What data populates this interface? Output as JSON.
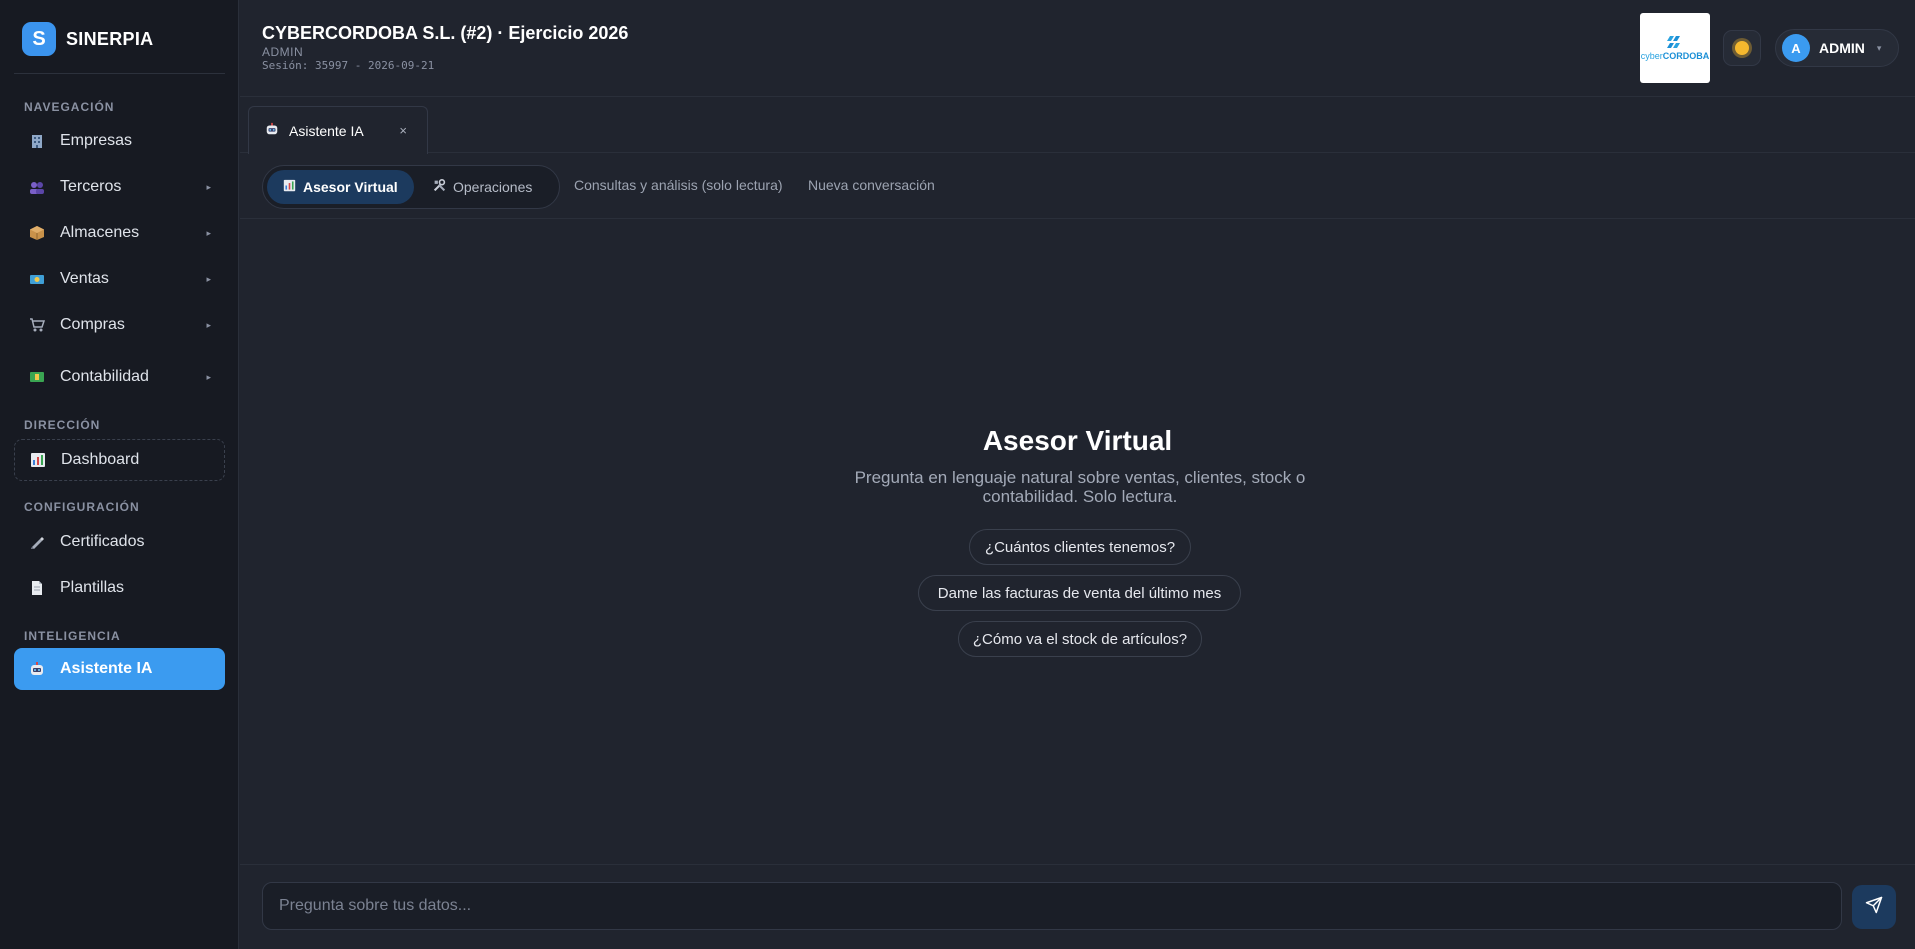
{
  "brand": {
    "logo_letter": "S",
    "name": "SINERPIA"
  },
  "sidebar": {
    "sections": {
      "navigation": "NAVEGACIÓN",
      "direction": "DIRECCIÓN",
      "configuration": "CONFIGURACIÓN",
      "intelligence": "INTELIGENCIA"
    },
    "items": [
      {
        "label": "Empresas",
        "icon": "building-icon"
      },
      {
        "label": "Terceros",
        "icon": "people-icon",
        "has_submenu": true
      },
      {
        "label": "Almacenes",
        "icon": "package-icon",
        "has_submenu": true
      },
      {
        "label": "Ventas",
        "icon": "money-icon",
        "has_submenu": true
      },
      {
        "label": "Compras",
        "icon": "cart-icon",
        "has_submenu": true
      },
      {
        "label": "Contabilidad",
        "icon": "ledger-icon",
        "has_submenu": true
      },
      {
        "label": "Dashboard",
        "icon": "bar-chart-icon"
      },
      {
        "label": "Certificados",
        "icon": "pen-icon"
      },
      {
        "label": "Plantillas",
        "icon": "document-icon"
      },
      {
        "label": "Asistente IA",
        "icon": "robot-icon",
        "active": true
      }
    ]
  },
  "header": {
    "company": "CYBERCORDOBA S.L. (#2) · Ejercicio 2026",
    "role": "ADMIN",
    "session": "Sesión: 35997 - 2026-09-21",
    "logo_text_a": "cyber",
    "logo_text_b": "CORDOBA",
    "user_initial": "A",
    "user_name": "ADMIN"
  },
  "tabs": [
    {
      "label": "Asistente IA",
      "close": "×"
    }
  ],
  "subnav": {
    "segments": [
      {
        "label": "Asesor Virtual",
        "active": true
      },
      {
        "label": "Operaciones",
        "active": false
      }
    ],
    "links": [
      "Consultas y análisis (solo lectura)",
      "Nueva conversación"
    ]
  },
  "main": {
    "title": "Asesor Virtual",
    "description": "Pregunta en lenguaje natural sobre ventas, clientes, stock o contabilidad. Solo lectura.",
    "suggestions": [
      "¿Cuántos clientes tenemos?",
      "Dame las facturas de venta del último mes",
      "¿Cómo va el stock de artículos?"
    ]
  },
  "composer": {
    "placeholder": "Pregunta sobre tus datos..."
  },
  "colors": {
    "accent": "#3b9bf0",
    "background": "#20242e",
    "sidebar": "#171a22",
    "segment_active": "#1c3a5e"
  }
}
